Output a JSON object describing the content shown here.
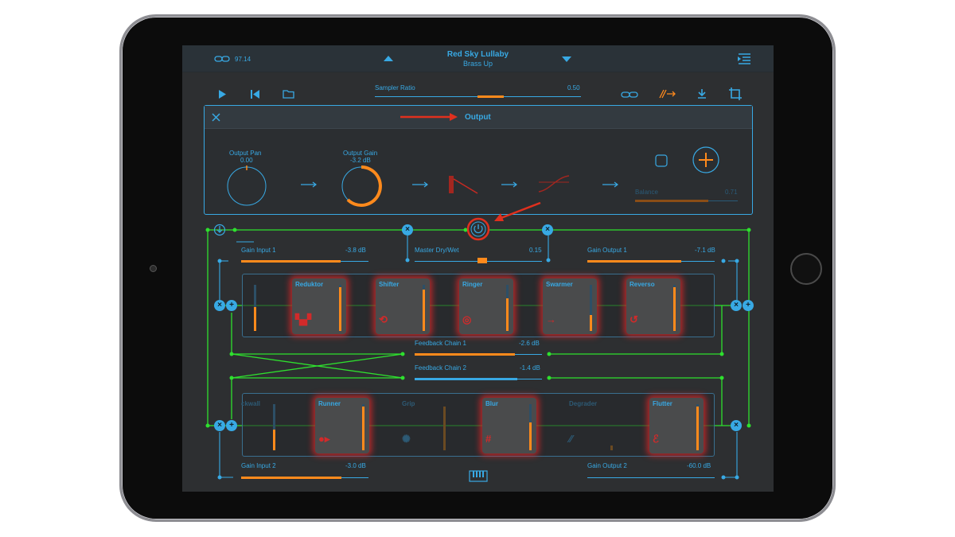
{
  "app": {
    "song_title": "Red Sky Lullaby",
    "preset_name": "Brass Up",
    "tempo_value": "97.14"
  },
  "toolbar": {
    "sampler_ratio_label": "Sampler Ratio",
    "sampler_ratio_value": "0.50",
    "sampler_ratio_level": 0.5
  },
  "output_panel": {
    "title": "Output",
    "pan_label": "Output Pan",
    "pan_value": "0.00",
    "gain_label": "Output Gain",
    "gain_value": "-3.2 dB",
    "balance_label": "Balance",
    "balance_value": "0.71"
  },
  "routing": {
    "master_drywet_label": "Master Dry/Wet",
    "master_drywet_value": "0.15",
    "gain_input_1_label": "Gain Input 1",
    "gain_input_1_value": "-3.8 dB",
    "gain_output_1_label": "Gain Output 1",
    "gain_output_1_value": "-7.1 dB",
    "feedback_1_label": "Feedback Chain 1",
    "feedback_1_value": "-2.6 dB",
    "feedback_2_label": "Feedback Chain 2",
    "feedback_2_value": "-1.4 dB",
    "gain_input_2_label": "Gain Input 2",
    "gain_input_2_value": "-3.0 dB",
    "gain_output_2_label": "Gain Output 2",
    "gain_output_2_value": "-60.0 dB"
  },
  "chain_1": [
    {
      "name": "Reduktor",
      "level": 0.95
    },
    {
      "name": "Shifter",
      "level": 0.9
    },
    {
      "name": "Ringer",
      "level": 0.7
    },
    {
      "name": "Swarmer",
      "level": 0.35
    },
    {
      "name": "Reverso",
      "level": 0.95
    }
  ],
  "chain_2": [
    {
      "name": "ckwall",
      "level": 0.45
    },
    {
      "name": "Runner",
      "level": 0.95
    },
    {
      "name": "Grip",
      "level": 0.95
    },
    {
      "name": "Blur",
      "level": 0.6
    },
    {
      "name": "Degrader",
      "level": 0.1
    },
    {
      "name": "Flutter",
      "level": 0.95
    }
  ],
  "colors": {
    "accent_blue": "#38a9e4",
    "accent_orange": "#ff8a1c",
    "route_green": "#2ee02e",
    "highlight_red": "#e0301e"
  }
}
